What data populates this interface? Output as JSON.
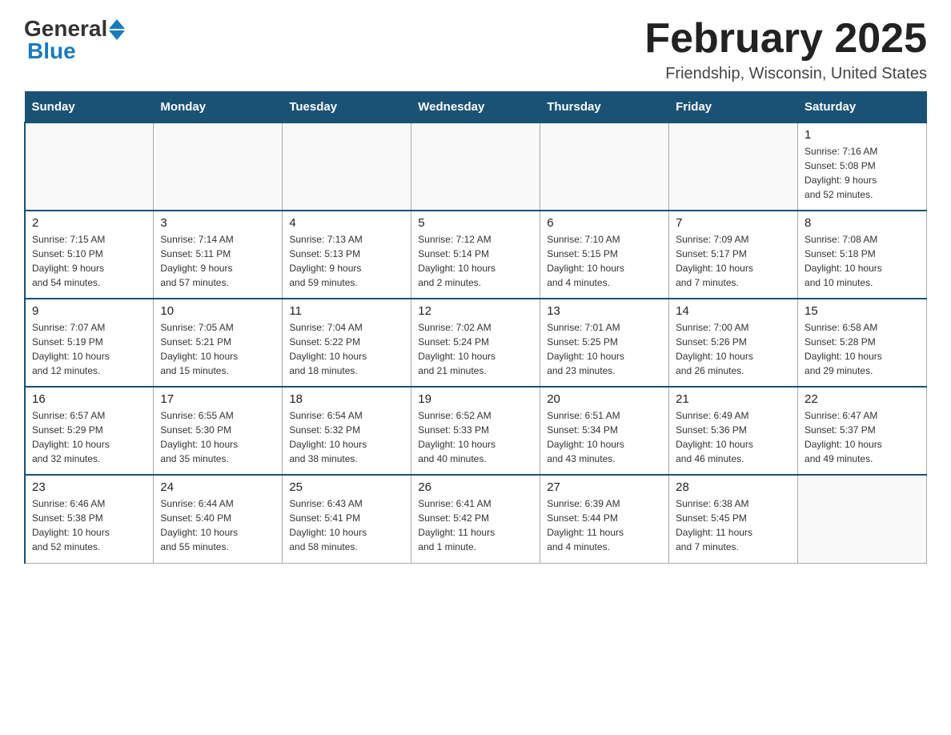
{
  "header": {
    "logo_general": "General",
    "logo_blue": "Blue",
    "month_title": "February 2025",
    "location": "Friendship, Wisconsin, United States"
  },
  "weekdays": [
    "Sunday",
    "Monday",
    "Tuesday",
    "Wednesday",
    "Thursday",
    "Friday",
    "Saturday"
  ],
  "weeks": [
    [
      {
        "day": "",
        "info": ""
      },
      {
        "day": "",
        "info": ""
      },
      {
        "day": "",
        "info": ""
      },
      {
        "day": "",
        "info": ""
      },
      {
        "day": "",
        "info": ""
      },
      {
        "day": "",
        "info": ""
      },
      {
        "day": "1",
        "info": "Sunrise: 7:16 AM\nSunset: 5:08 PM\nDaylight: 9 hours\nand 52 minutes."
      }
    ],
    [
      {
        "day": "2",
        "info": "Sunrise: 7:15 AM\nSunset: 5:10 PM\nDaylight: 9 hours\nand 54 minutes."
      },
      {
        "day": "3",
        "info": "Sunrise: 7:14 AM\nSunset: 5:11 PM\nDaylight: 9 hours\nand 57 minutes."
      },
      {
        "day": "4",
        "info": "Sunrise: 7:13 AM\nSunset: 5:13 PM\nDaylight: 9 hours\nand 59 minutes."
      },
      {
        "day": "5",
        "info": "Sunrise: 7:12 AM\nSunset: 5:14 PM\nDaylight: 10 hours\nand 2 minutes."
      },
      {
        "day": "6",
        "info": "Sunrise: 7:10 AM\nSunset: 5:15 PM\nDaylight: 10 hours\nand 4 minutes."
      },
      {
        "day": "7",
        "info": "Sunrise: 7:09 AM\nSunset: 5:17 PM\nDaylight: 10 hours\nand 7 minutes."
      },
      {
        "day": "8",
        "info": "Sunrise: 7:08 AM\nSunset: 5:18 PM\nDaylight: 10 hours\nand 10 minutes."
      }
    ],
    [
      {
        "day": "9",
        "info": "Sunrise: 7:07 AM\nSunset: 5:19 PM\nDaylight: 10 hours\nand 12 minutes."
      },
      {
        "day": "10",
        "info": "Sunrise: 7:05 AM\nSunset: 5:21 PM\nDaylight: 10 hours\nand 15 minutes."
      },
      {
        "day": "11",
        "info": "Sunrise: 7:04 AM\nSunset: 5:22 PM\nDaylight: 10 hours\nand 18 minutes."
      },
      {
        "day": "12",
        "info": "Sunrise: 7:02 AM\nSunset: 5:24 PM\nDaylight: 10 hours\nand 21 minutes."
      },
      {
        "day": "13",
        "info": "Sunrise: 7:01 AM\nSunset: 5:25 PM\nDaylight: 10 hours\nand 23 minutes."
      },
      {
        "day": "14",
        "info": "Sunrise: 7:00 AM\nSunset: 5:26 PM\nDaylight: 10 hours\nand 26 minutes."
      },
      {
        "day": "15",
        "info": "Sunrise: 6:58 AM\nSunset: 5:28 PM\nDaylight: 10 hours\nand 29 minutes."
      }
    ],
    [
      {
        "day": "16",
        "info": "Sunrise: 6:57 AM\nSunset: 5:29 PM\nDaylight: 10 hours\nand 32 minutes."
      },
      {
        "day": "17",
        "info": "Sunrise: 6:55 AM\nSunset: 5:30 PM\nDaylight: 10 hours\nand 35 minutes."
      },
      {
        "day": "18",
        "info": "Sunrise: 6:54 AM\nSunset: 5:32 PM\nDaylight: 10 hours\nand 38 minutes."
      },
      {
        "day": "19",
        "info": "Sunrise: 6:52 AM\nSunset: 5:33 PM\nDaylight: 10 hours\nand 40 minutes."
      },
      {
        "day": "20",
        "info": "Sunrise: 6:51 AM\nSunset: 5:34 PM\nDaylight: 10 hours\nand 43 minutes."
      },
      {
        "day": "21",
        "info": "Sunrise: 6:49 AM\nSunset: 5:36 PM\nDaylight: 10 hours\nand 46 minutes."
      },
      {
        "day": "22",
        "info": "Sunrise: 6:47 AM\nSunset: 5:37 PM\nDaylight: 10 hours\nand 49 minutes."
      }
    ],
    [
      {
        "day": "23",
        "info": "Sunrise: 6:46 AM\nSunset: 5:38 PM\nDaylight: 10 hours\nand 52 minutes."
      },
      {
        "day": "24",
        "info": "Sunrise: 6:44 AM\nSunset: 5:40 PM\nDaylight: 10 hours\nand 55 minutes."
      },
      {
        "day": "25",
        "info": "Sunrise: 6:43 AM\nSunset: 5:41 PM\nDaylight: 10 hours\nand 58 minutes."
      },
      {
        "day": "26",
        "info": "Sunrise: 6:41 AM\nSunset: 5:42 PM\nDaylight: 11 hours\nand 1 minute."
      },
      {
        "day": "27",
        "info": "Sunrise: 6:39 AM\nSunset: 5:44 PM\nDaylight: 11 hours\nand 4 minutes."
      },
      {
        "day": "28",
        "info": "Sunrise: 6:38 AM\nSunset: 5:45 PM\nDaylight: 11 hours\nand 7 minutes."
      },
      {
        "day": "",
        "info": ""
      }
    ]
  ]
}
